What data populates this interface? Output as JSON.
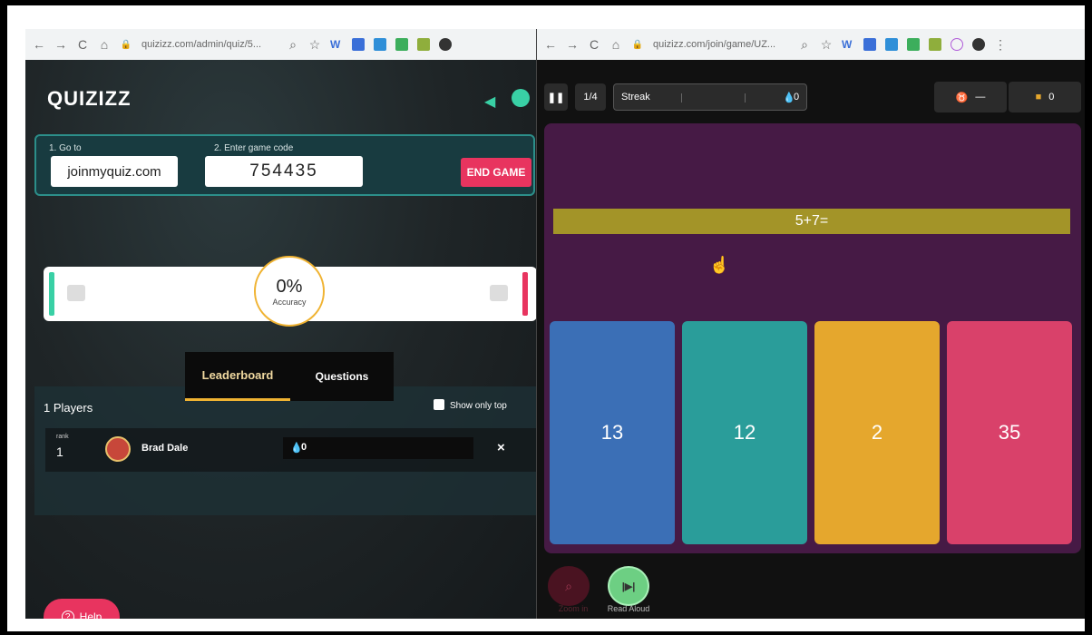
{
  "left_browser": {
    "url": "quizizz.com/admin/quiz/5..."
  },
  "right_browser": {
    "url": "quizizz.com/join/game/UZ..."
  },
  "admin": {
    "logo": "QUIZIZZ",
    "step1_label": "1. Go to",
    "join_url": "joinmyquiz.com",
    "step2_label": "2. Enter game code",
    "game_code": "754435",
    "end_game_label": "END GAME",
    "accuracy_value": "0%",
    "accuracy_label": "Accuracy",
    "tab_leaderboard": "Leaderboard",
    "tab_questions": "Questions",
    "players_count": "1 Players",
    "show_only_top": "Show only top",
    "players": [
      {
        "rank_label": "rank",
        "rank": "1",
        "name": "Brad Dale",
        "score": "0"
      }
    ],
    "help_label": "Help"
  },
  "game": {
    "progress": "1/4",
    "streak_label": "Streak",
    "streak_score": "0",
    "powerup_value": "—",
    "coins": "0",
    "question": "5+7=",
    "answers": [
      {
        "label": "13",
        "color": "#3b6fb6"
      },
      {
        "label": "12",
        "color": "#2a9d9a"
      },
      {
        "label": "2",
        "color": "#e5a72d"
      },
      {
        "label": "35",
        "color": "#d9416a"
      }
    ],
    "zoom_label": "Zoom in",
    "read_aloud_label": "Read Aloud"
  },
  "colors": {
    "accent_red": "#e8345f",
    "accent_teal": "#39d0a5",
    "question_bar": "#a39428",
    "card_purple": "#461a45"
  }
}
